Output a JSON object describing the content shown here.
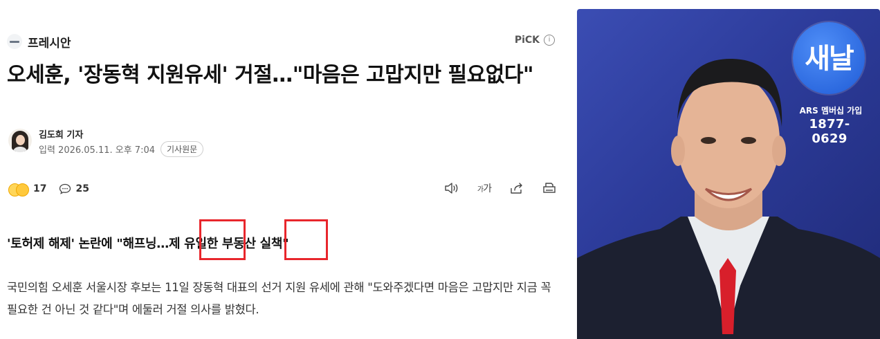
{
  "article": {
    "press_name": "프레시안",
    "pick_label": "PiCK",
    "pick_info_symbol": "i",
    "headline": "오세훈, '장동혁 지원유세' 거절…\"마음은 고맙지만 필요없다\"",
    "reporter": "김도희 기자",
    "dateline": "입력 2026.05.11. 오후 7:04",
    "original_button": "기사원문",
    "reactions": {
      "emoji_count": "17",
      "comment_count": "25"
    },
    "tools": {
      "font_size_small": "가",
      "font_size_large": "가"
    },
    "subheading": "'토허제 해제' 논란에 \"해프닝…제 유일한 부동산 실책\"",
    "body": "국민의힘 오세훈 서울시장 후보는 11일 장동혁 대표의 선거 지원 유세에 관해 \"도와주겠다면 마음은 고맙지만 지금 꼭 필요한 건 아닌 것 같다\"며 에둘러 거절 의사를 밝혔다."
  },
  "photo": {
    "logo_text": "새날",
    "member_label": "ARS 멤버십 가입",
    "phone": "1877-0629"
  },
  "colors": {
    "highlight_box": "#e8262c",
    "background": "#ffffff",
    "photo_backdrop": "#2d3c9b"
  },
  "icons": [
    "press-logo-icon",
    "info-icon",
    "emoji-reaction-icon",
    "comment-icon",
    "speaker-icon",
    "font-size-icon",
    "share-icon",
    "print-icon"
  ]
}
